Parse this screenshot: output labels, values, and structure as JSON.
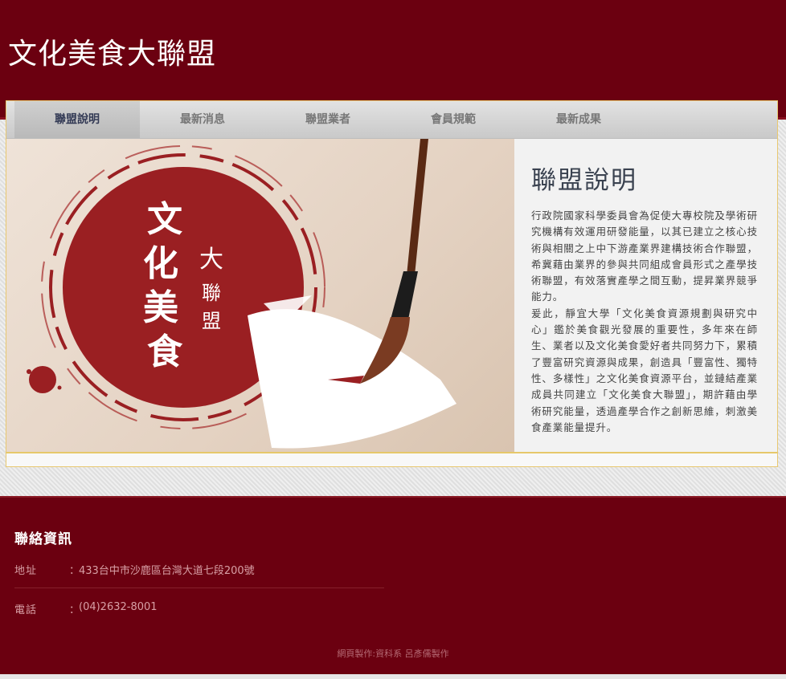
{
  "header": {
    "title": "文化美食大聯盟"
  },
  "nav": {
    "items": [
      {
        "label": "聯盟說明",
        "active": true
      },
      {
        "label": "最新消息",
        "active": false
      },
      {
        "label": "聯盟業者",
        "active": false
      },
      {
        "label": "會員規範",
        "active": false
      },
      {
        "label": "最新成果",
        "active": false
      }
    ]
  },
  "banner": {
    "logo_text_main": "文化美食",
    "logo_text_side": "大聯盟",
    "colors": {
      "ink_red": "#9a1f22",
      "paper": "#ede0d4"
    }
  },
  "content": {
    "title": "聯盟說明",
    "paragraph_1": "行政院國家科學委員會為促使大專校院及學術研究機構有效運用研發能量，以其已建立之核心技術與相關之上中下游產業界建構技術合作聯盟，希冀藉由業界的參與共同組成會員形式之產學技術聯盟，有效落實產學之間互動，提昇業界競爭能力。",
    "paragraph_2": "爰此，靜宜大學「文化美食資源規劃與研究中心」鑑於美食觀光發展的重要性，多年來在師生、業者以及文化美食愛好者共同努力下，累積了豐富研究資源與成果，創造具「豐富性、獨特性、多樣性」之文化美食資源平台，並鏈結產業成員共同建立「文化美食大聯盟」，期許藉由學術研究能量，透過產學合作之創新思維，刺激美食產業能量提升。"
  },
  "footer": {
    "heading": "聯絡資訊",
    "address_label": "地址",
    "address_value": "433台中市沙鹿區台灣大道七段200號",
    "phone_label": "電話",
    "phone_value": "(04)2632-8001",
    "colon": "：",
    "credit": "網頁製作:資科系 呂彥儒製作"
  },
  "colors": {
    "brand": "#6b0010",
    "gold_border": "#e6c86a"
  }
}
